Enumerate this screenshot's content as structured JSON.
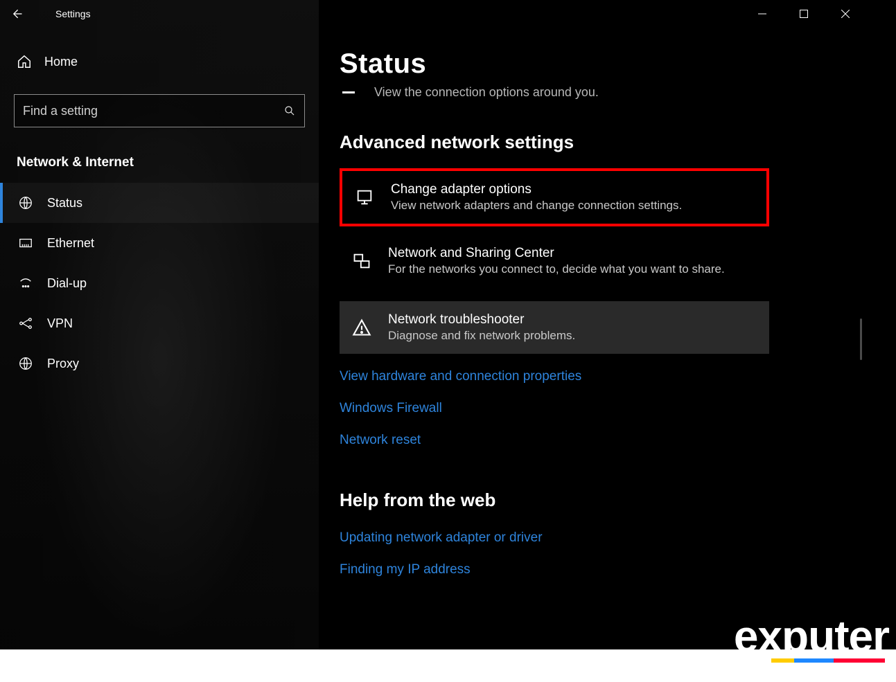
{
  "window": {
    "title": "Settings"
  },
  "sidebar": {
    "home": "Home",
    "search_placeholder": "Find a setting",
    "section": "Network & Internet",
    "items": [
      {
        "label": "Status",
        "icon": "globe-net-icon",
        "active": true
      },
      {
        "label": "Ethernet",
        "icon": "ethernet-icon",
        "active": false
      },
      {
        "label": "Dial-up",
        "icon": "dialup-icon",
        "active": false
      },
      {
        "label": "VPN",
        "icon": "vpn-icon",
        "active": false
      },
      {
        "label": "Proxy",
        "icon": "globe-icon",
        "active": false
      }
    ]
  },
  "main": {
    "heading": "Status",
    "scroll_hint": "View the connection options around you.",
    "section1": "Advanced network settings",
    "tiles": [
      {
        "title": "Change adapter options",
        "desc": "View network adapters and change connection settings.",
        "icon": "adapter-icon",
        "highlight": true
      },
      {
        "title": "Network and Sharing Center",
        "desc": "For the networks you connect to, decide what you want to share.",
        "icon": "sharing-icon",
        "highlight": false
      },
      {
        "title": "Network troubleshooter",
        "desc": "Diagnose and fix network problems.",
        "icon": "warning-icon",
        "highlight": false,
        "trouble": true
      }
    ],
    "links": [
      "View hardware and connection properties",
      "Windows Firewall",
      "Network reset"
    ],
    "help_heading": "Help from the web",
    "help_links": [
      "Updating network adapter or driver",
      "Finding my IP address"
    ]
  },
  "watermark": "exputer"
}
